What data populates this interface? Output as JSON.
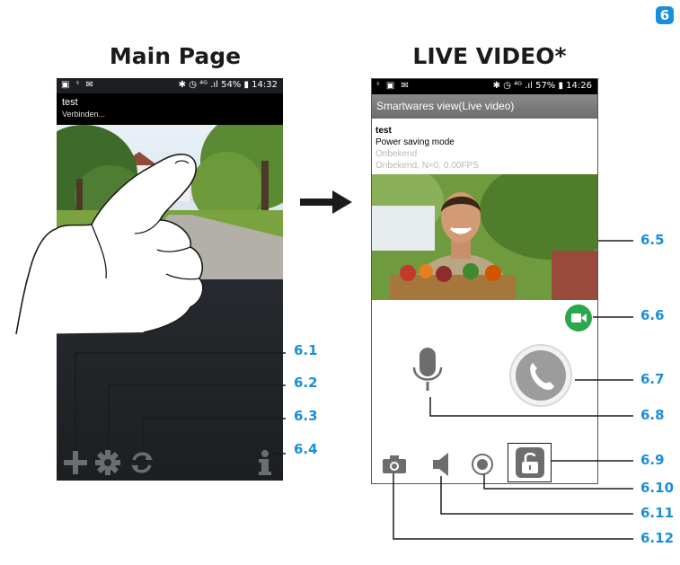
{
  "page_badge": "6",
  "main_page": {
    "title": "Main Page",
    "status": {
      "left": "▣ ˢ ✉",
      "right": "✱ ◷ ⁴ᴳ .ıl 54% ▮ 14:32"
    },
    "device_name": "test",
    "connection_status": "Verbinden...",
    "toolbar_icons": [
      "plus-icon",
      "gear-icon",
      "refresh-icon",
      "info-icon"
    ]
  },
  "live_video": {
    "title": "LIVE VIDEO*",
    "status": {
      "left": "ˢ ▣ ✉",
      "right": "✱ ◷ ⁴ᴳ .ıl 57% ▮ 14:26"
    },
    "app_bar_title": "Smartwares view(Live video)",
    "device_name": "test",
    "mode": "Power saving mode",
    "line3": "Onbekend",
    "line4": "Onbekend, N=0, 0.00FPS"
  },
  "callouts": {
    "c1": "6.1",
    "c2": "6.2",
    "c3": "6.3",
    "c4": "6.4",
    "c5": "6.5",
    "c6": "6.6",
    "c7": "6.7",
    "c8": "6.8",
    "c9": "6.9",
    "c10": "6.10",
    "c11": "6.11",
    "c12": "6.12"
  },
  "colors": {
    "accent": "#1a8fd8",
    "record_green": "#2aa84a",
    "dark_bg": "#1b1f23"
  }
}
